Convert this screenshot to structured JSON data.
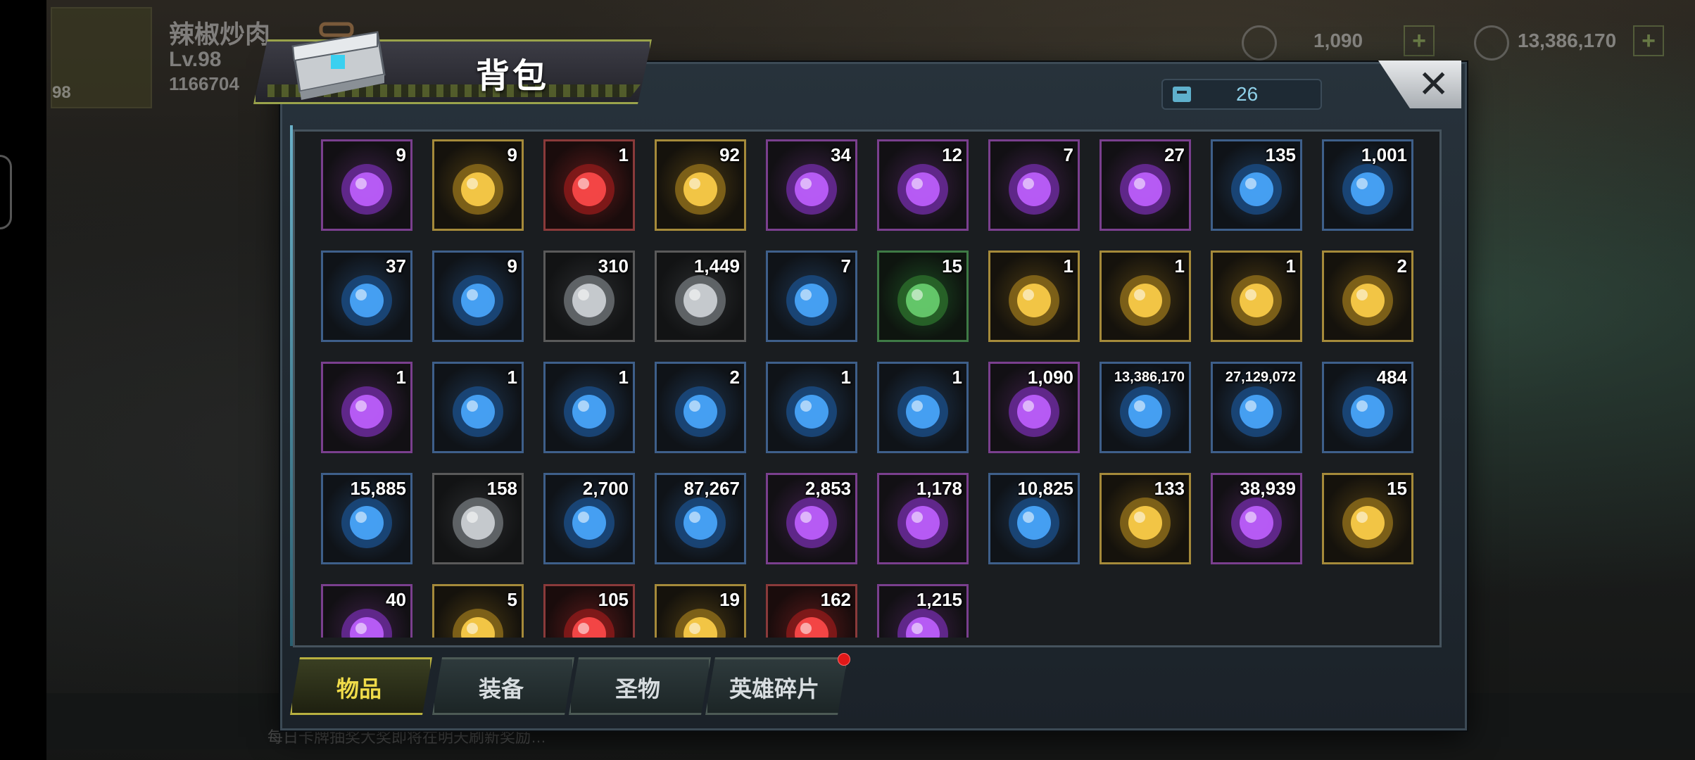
{
  "hud": {
    "player_name": "辣椒炒肉",
    "level": "Lv.98",
    "power": "1166704",
    "avatar_level": "98",
    "gems": "1,090",
    "gold": "13,386,170"
  },
  "chat": {
    "text": "每日卡牌抽奖大奖即将在明天刷新奖励…"
  },
  "panel": {
    "title": "背包",
    "capacity": "26",
    "close_label": "✕"
  },
  "tabs": [
    {
      "label": "物品",
      "active": true
    },
    {
      "label": "装备",
      "active": false
    },
    {
      "label": "圣物",
      "active": false
    },
    {
      "label": "英雄碎片",
      "active": false,
      "has_notification": true
    }
  ],
  "items": [
    {
      "icon": "arrow-device-icon",
      "count": "9",
      "rarity": "purple"
    },
    {
      "icon": "24h-card-icon",
      "count": "9",
      "rarity": "gold"
    },
    {
      "icon": "hammer-icon",
      "count": "1",
      "rarity": "red"
    },
    {
      "icon": "red-orb-icon",
      "count": "92",
      "rarity": "gold"
    },
    {
      "icon": "film-reel-icon",
      "count": "34",
      "rarity": "purple"
    },
    {
      "icon": "s-bottlecap-icon",
      "count": "12",
      "rarity": "purple"
    },
    {
      "icon": "spade-chip-icon",
      "count": "7",
      "rarity": "purple"
    },
    {
      "icon": "police-badge-icon",
      "count": "27",
      "rarity": "purple"
    },
    {
      "icon": "gold-leaf-icon",
      "count": "135",
      "rarity": "blue"
    },
    {
      "icon": "cinema-ticket-icon",
      "count": "1,001",
      "rarity": "blue"
    },
    {
      "icon": "stopwatch-icon",
      "count": "37",
      "rarity": "blue"
    },
    {
      "icon": "b-bottlecap-icon",
      "count": "9",
      "rarity": "blue"
    },
    {
      "icon": "heart-chip-icon",
      "count": "310",
      "rarity": "grey"
    },
    {
      "icon": "bullet-icon",
      "count": "1,449",
      "rarity": "grey"
    },
    {
      "icon": "sunflower-icon",
      "count": "7",
      "rarity": "blue"
    },
    {
      "icon": "pinecone-icon",
      "count": "15",
      "rarity": "green"
    },
    {
      "icon": "boot-scroll-icon",
      "count": "1",
      "rarity": "gold"
    },
    {
      "icon": "ring-scroll-icon",
      "count": "1",
      "rarity": "gold"
    },
    {
      "icon": "pistol-scroll-icon",
      "count": "1",
      "rarity": "gold"
    },
    {
      "icon": "sword-scroll-icon",
      "count": "2",
      "rarity": "gold"
    },
    {
      "icon": "shirt-blueprint-purple-icon",
      "count": "1",
      "rarity": "purple"
    },
    {
      "icon": "shirt-blueprint-icon",
      "count": "1",
      "rarity": "blue"
    },
    {
      "icon": "boot-blueprint-icon",
      "count": "1",
      "rarity": "blue"
    },
    {
      "icon": "ring-blueprint-icon",
      "count": "2",
      "rarity": "blue"
    },
    {
      "icon": "pistol-blueprint-icon",
      "count": "1",
      "rarity": "blue"
    },
    {
      "icon": "sword-blueprint-icon",
      "count": "1",
      "rarity": "blue"
    },
    {
      "icon": "purple-gem-icon",
      "count": "1,090",
      "rarity": "purple"
    },
    {
      "icon": "gold-coins-icon",
      "count": "13,386,170",
      "rarity": "blue"
    },
    {
      "icon": "green-canister-icon",
      "count": "27,129,072",
      "rarity": "blue"
    },
    {
      "icon": "purple-core-icon",
      "count": "484",
      "rarity": "blue"
    },
    {
      "icon": "gear-icon",
      "count": "15,885",
      "rarity": "blue"
    },
    {
      "icon": "red-molecule-icon",
      "count": "158",
      "rarity": "grey"
    },
    {
      "icon": "eye-helmet-icon",
      "count": "2,700",
      "rarity": "blue"
    },
    {
      "icon": "crystal-shard-icon",
      "count": "87,267",
      "rarity": "blue"
    },
    {
      "icon": "fist-icon",
      "count": "2,853",
      "rarity": "purple"
    },
    {
      "icon": "puzzle-piece-icon",
      "count": "1,178",
      "rarity": "purple"
    },
    {
      "icon": "ship-token-icon",
      "count": "10,825",
      "rarity": "blue"
    },
    {
      "icon": "gold-ship-token-icon",
      "count": "133",
      "rarity": "gold"
    },
    {
      "icon": "red-hex-icon",
      "count": "38,939",
      "rarity": "purple"
    },
    {
      "icon": "orange-crystal-icon",
      "count": "15",
      "rarity": "gold"
    },
    {
      "icon": "lightning-orb-icon",
      "count": "40",
      "rarity": "purple"
    },
    {
      "icon": "fairy-token-icon",
      "count": "5",
      "rarity": "gold"
    },
    {
      "icon": "pink-flower-icon",
      "count": "105",
      "rarity": "red"
    },
    {
      "icon": "orange-shield-icon",
      "count": "19",
      "rarity": "gold"
    },
    {
      "icon": "red-target-icon",
      "count": "162",
      "rarity": "red"
    },
    {
      "icon": "silver-orb-icon",
      "count": "1,215",
      "rarity": "purple"
    }
  ],
  "colors": {
    "tab_active_text": "#f0dc4a",
    "tab_text": "#d8dde0",
    "panel_border": "#3c4a55",
    "capacity_text": "#8fd0e8",
    "notification": "#e01818"
  }
}
